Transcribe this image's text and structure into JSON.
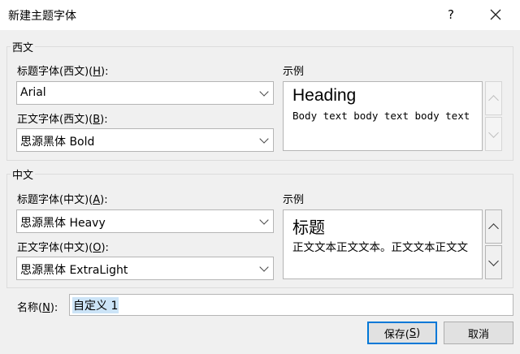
{
  "dialog": {
    "title": "新建主题字体",
    "help_label": "?",
    "close_label": "✕"
  },
  "western": {
    "group_label": "西文",
    "heading_label": "标题字体(西文)(",
    "heading_key": "H",
    "heading_label_end": "):",
    "heading_value": "Arial",
    "body_label": "正文字体(西文)(",
    "body_key": "B",
    "body_label_end": "):",
    "body_value": "思源黑体 Bold",
    "sample_label": "示例",
    "sample_heading": "Heading",
    "sample_body": "Body text body text body text"
  },
  "chinese": {
    "group_label": "中文",
    "heading_label": "标题字体(中文)(",
    "heading_key": "A",
    "heading_label_end": "):",
    "heading_value": "思源黑体 Heavy",
    "body_label": "正文字体(中文)(",
    "body_key": "O",
    "body_label_end": "):",
    "body_value": "思源黑体 ExtraLight",
    "sample_label": "示例",
    "sample_heading": "标题",
    "sample_body": "正文文本正文文本。正文文本正文文"
  },
  "name": {
    "label": "名称(",
    "key": "N",
    "label_end": "):",
    "value": "自定义 1"
  },
  "buttons": {
    "save_label": "保存(",
    "save_key": "S",
    "save_label_end": ")",
    "cancel_label": "取消"
  }
}
